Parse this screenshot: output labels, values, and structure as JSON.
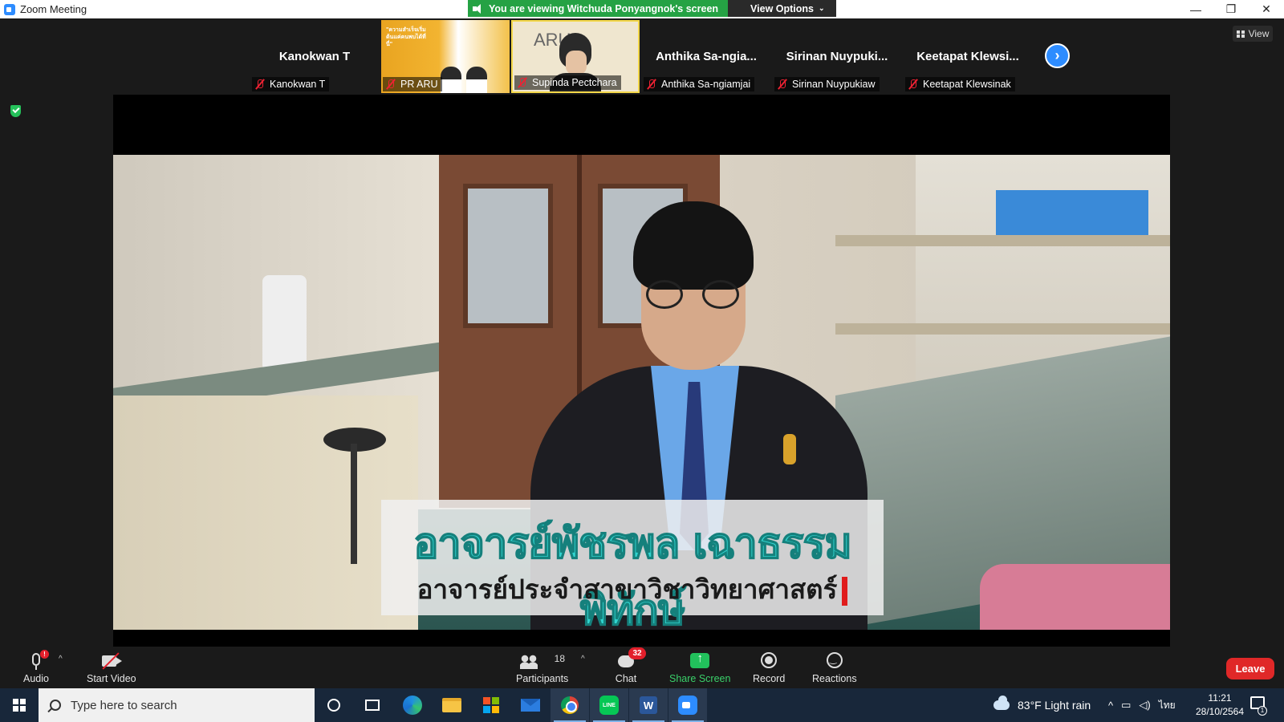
{
  "window": {
    "title": "Zoom Meeting",
    "controls": {
      "minimize": "—",
      "restore": "❐",
      "close": "✕"
    }
  },
  "share_banner": {
    "status": "You are viewing Witchuda Ponyangnok's screen",
    "view_options": "View Options"
  },
  "view_button": "View",
  "participants_strip": [
    {
      "big_name": "Kanokwan T",
      "label": "Kanokwan T",
      "video": false
    },
    {
      "big_name": "",
      "label": "PR ARU",
      "video": true,
      "poster_text": "\"ความสำเร็จเริ่มต้นแค่คนพบได้ที่นี่\""
    },
    {
      "big_name": "",
      "label": "Supinda Pectchara",
      "video": true,
      "poster_text": "ARU"
    },
    {
      "big_name": "Anthika Sa-ngia...",
      "label": "Anthika Sa-ngiamjai",
      "video": false
    },
    {
      "big_name": "Sirinan Nuypuki...",
      "label": "Sirinan Nuypukiaw",
      "video": false
    },
    {
      "big_name": "Keetapat Klewsi...",
      "label": "Keetapat Klewsinak",
      "video": false
    }
  ],
  "shared_screen": {
    "caption_name": "อาจารย์พัชรพล เฉาธรรมพิทักษ์",
    "caption_role": "อาจารย์ประจำสาขาวิชาวิทยาศาสตร์"
  },
  "toolbar": {
    "audio": "Audio",
    "audio_alert": "!",
    "start_video": "Start Video",
    "participants": "Participants",
    "participants_count": "18",
    "chat": "Chat",
    "chat_badge": "32",
    "share_screen": "Share Screen",
    "record": "Record",
    "reactions": "Reactions",
    "leave": "Leave"
  },
  "taskbar": {
    "search_placeholder": "Type here to search",
    "weather": "83°F  Light rain",
    "language": "ไทย",
    "time": "11:21",
    "date": "28/10/2564",
    "notification_count": "1"
  },
  "colors": {
    "zoom_blue": "#2d8cff",
    "share_green": "#25a244",
    "leave_red": "#e02828",
    "caption_cyan": "#31d4cf"
  }
}
